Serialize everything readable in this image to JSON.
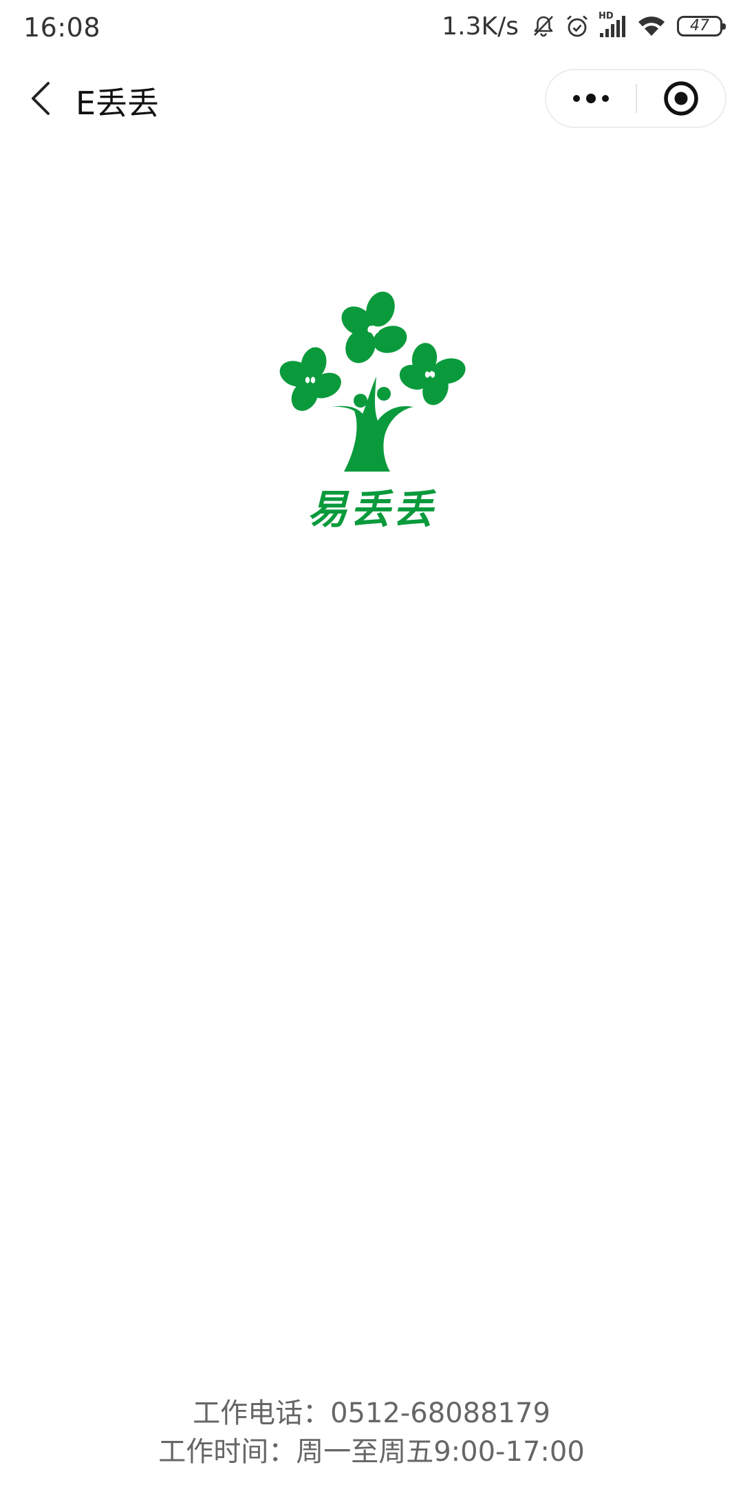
{
  "status_bar": {
    "time": "16:08",
    "net_speed": "1.3K/s",
    "hd_label": "HD",
    "battery_level": "47"
  },
  "nav_bar": {
    "title": "E丢丢"
  },
  "logo": {
    "wordmark": "易丢丢",
    "brand_color": "#0a9a3c"
  },
  "footer": {
    "phone_label": "工作电话：",
    "phone": "0512-68088179",
    "hours_label": "工作时间：",
    "hours": "周一至周五9:00-17:00"
  },
  "icons": [
    "mute-bell-icon",
    "alarm-icon",
    "signal-icon",
    "wifi-icon",
    "battery-icon",
    "back-arrow-icon",
    "more-dots-icon",
    "close-miniprogram-icon"
  ]
}
